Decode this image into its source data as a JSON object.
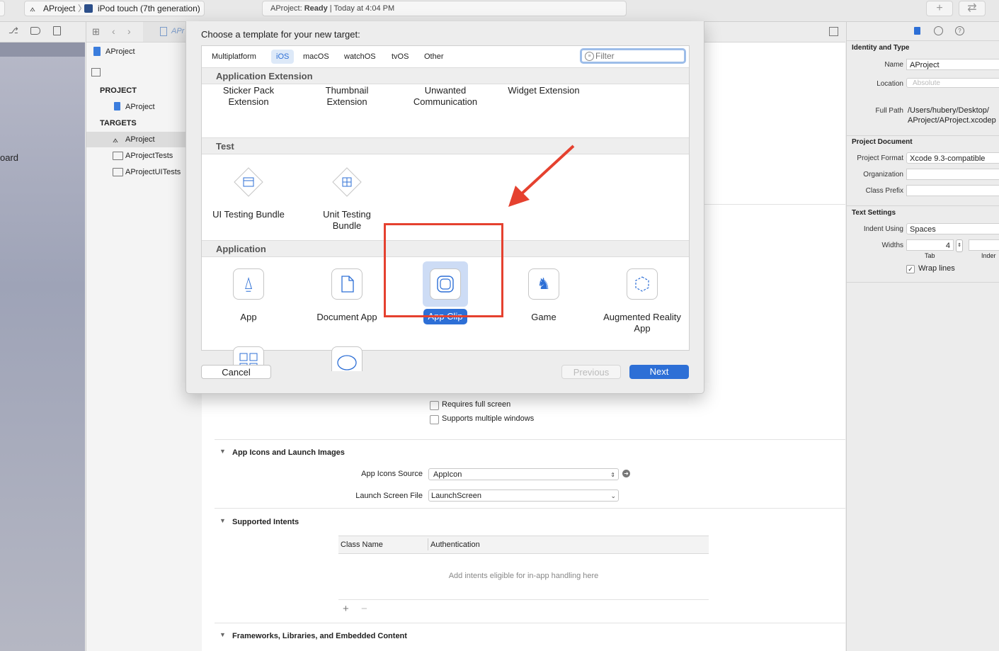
{
  "toolbar": {
    "scheme_name": "AProject",
    "destination": "iPod touch (7th generation)",
    "status_project": "AProject:",
    "status_state": "Ready",
    "status_time": "| Today at 4:04 PM",
    "add_symbol": "+",
    "swap_symbol": "⇄"
  },
  "left_pane": {
    "partial_label": "oard"
  },
  "navigator": {
    "breadcrumb": "AProject",
    "project_header": "PROJECT",
    "project_item": "AProject",
    "targets_header": "TARGETS",
    "targets": [
      "AProject",
      "AProjectTests",
      "AProjectUITests"
    ],
    "tab_partial": "APr"
  },
  "dialog": {
    "title": "Choose a template for your new target:",
    "platform_tabs": [
      "Multiplatform",
      "iOS",
      "macOS",
      "watchOS",
      "tvOS",
      "Other"
    ],
    "active_tab": "iOS",
    "filter_placeholder": "Filter",
    "sections": {
      "app_extension": {
        "title": "Application Extension",
        "items": [
          "Sticker Pack Extension",
          "Thumbnail Extension",
          "Unwanted Communication",
          "Widget Extension"
        ]
      },
      "test": {
        "title": "Test",
        "items": [
          "UI Testing Bundle",
          "Unit Testing Bundle"
        ]
      },
      "application": {
        "title": "Application",
        "items": [
          "App",
          "Document App",
          "App Clip",
          "Game",
          "Augmented Reality App"
        ],
        "selected": "App Clip"
      }
    },
    "cancel_label": "Cancel",
    "previous_label": "Previous",
    "next_label": "Next"
  },
  "editor": {
    "requires_full_screen": "Requires full screen",
    "supports_multiple_windows": "Supports multiple windows",
    "app_icons_section": "App Icons and Launch Images",
    "app_icons_source_label": "App Icons Source",
    "app_icons_source_value": "AppIcon",
    "launch_screen_label": "Launch Screen File",
    "launch_screen_value": "LaunchScreen",
    "intents_section": "Supported Intents",
    "intents_columns": [
      "Class Name",
      "Authentication"
    ],
    "intents_empty": "Add intents eligible for in-app handling here",
    "add_symbol": "+",
    "remove_symbol": "−",
    "frameworks_section": "Frameworks, Libraries, and Embedded Content"
  },
  "inspector": {
    "identity_title": "Identity and Type",
    "name_label": "Name",
    "name_value": "AProject",
    "location_label": "Location",
    "location_value": "Absolute",
    "full_path_label": "Full Path",
    "full_path_line1": "/Users/hubery/Desktop/",
    "full_path_line2": "AProject/AProject.xcodep",
    "project_document_title": "Project Document",
    "project_format_label": "Project Format",
    "project_format_value": "Xcode 9.3-compatible",
    "organization_label": "Organization",
    "class_prefix_label": "Class Prefix",
    "text_settings_title": "Text Settings",
    "indent_using_label": "Indent Using",
    "indent_using_value": "Spaces",
    "widths_label": "Widths",
    "tab_width_value": "4",
    "tab_caption": "Tab",
    "indent_caption": "Inder",
    "wrap_lines_label": "Wrap lines"
  },
  "colors": {
    "accent": "#2d6fd6",
    "annotation_red": "#e5412f"
  }
}
